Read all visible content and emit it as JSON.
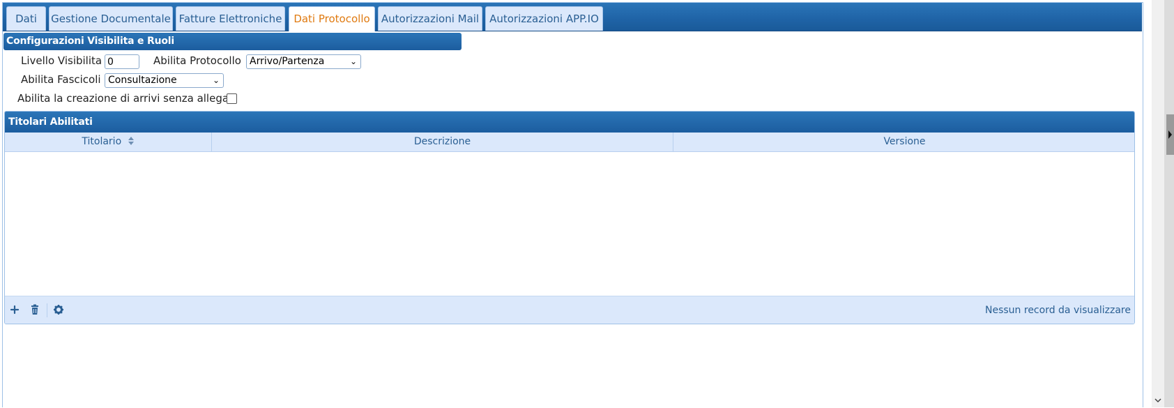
{
  "tabs": [
    {
      "label": "Dati",
      "active": false
    },
    {
      "label": "Gestione Documentale",
      "active": false
    },
    {
      "label": "Fatture Elettroniche",
      "active": false
    },
    {
      "label": "Dati Protocollo",
      "active": true
    },
    {
      "label": "Autorizzazioni Mail",
      "active": false
    },
    {
      "label": "Autorizzazioni APP.IO",
      "active": false
    }
  ],
  "section": {
    "title": "Configurazioni Visibilita e Ruoli",
    "livello_label": "Livello Visibilita",
    "livello_value": "0",
    "protocollo_label": "Abilita Protocollo",
    "protocollo_value": "Arrivo/Partenza",
    "fascicoli_label": "Abilita Fascicoli",
    "fascicoli_value": "Consultazione",
    "arrivi_label": "Abilita la creazione di arrivi senza allegati",
    "arrivi_checked": false
  },
  "grid": {
    "title": "Titolari Abilitati",
    "columns": [
      "Titolario",
      "Descrizione",
      "Versione"
    ],
    "sort_icon": "sort-icon",
    "footer_icons": [
      "add-icon",
      "delete-icon",
      "gear-icon"
    ],
    "pager_text": "Nessun record da visualizzare"
  },
  "colors": {
    "header_blue": "#1f63a6",
    "tab_bg": "#dbe8fb",
    "tab_text": "#2a5f93",
    "active_tab_text": "#e07a10"
  }
}
